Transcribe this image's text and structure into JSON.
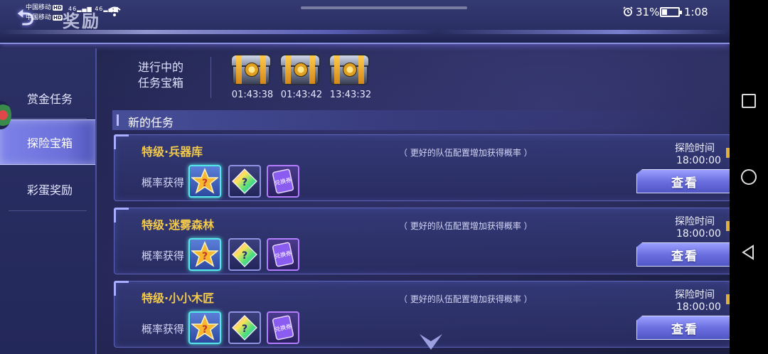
{
  "status_bar": {
    "carrier_1": "中国移动",
    "carrier_2": "中国移动",
    "hd_tag": "HD",
    "signal_1": "46",
    "signal_2": "46",
    "battery_percent": "31%",
    "battery_level": 0.31,
    "time": "1:08"
  },
  "header": {
    "title": "奖励",
    "back_icon": "back-arrow-icon"
  },
  "sidebar": {
    "items": [
      {
        "label": "赏金任务",
        "active": false
      },
      {
        "label": "探险宝箱",
        "active": true
      },
      {
        "label": "彩蛋奖励",
        "active": false
      }
    ]
  },
  "ongoing": {
    "label_line1": "进行中的",
    "label_line2": "任务宝箱",
    "chests": [
      {
        "icon": "treasure-chest-icon",
        "timer": "01:43:38"
      },
      {
        "icon": "treasure-chest-icon",
        "timer": "01:43:42"
      },
      {
        "icon": "treasure-chest-icon",
        "timer": "13:43:32"
      }
    ]
  },
  "new_tasks": {
    "title": "新的任务",
    "tasks": [
      {
        "name": "特级·兵器库",
        "hint": "（ 更好的队伍配置增加获得概率 ）",
        "time_label": "探险时间",
        "time": "18:00:00",
        "prob_label": "概率获得",
        "view_label": "查看",
        "rewards": [
          "star-mystery-icon",
          "gem-mystery-icon",
          "ticket-icon"
        ],
        "ticket_text": "兑换券"
      },
      {
        "name": "特级·迷雾森林",
        "hint": "（ 更好的队伍配置增加获得概率 ）",
        "time_label": "探险时间",
        "time": "18:00:00",
        "prob_label": "概率获得",
        "view_label": "查看",
        "rewards": [
          "star-mystery-icon",
          "gem-mystery-icon",
          "ticket-icon"
        ],
        "ticket_text": "兑换券"
      },
      {
        "name": "特级·小小木匠",
        "hint": "（ 更好的队伍配置增加获得概率 ）",
        "time_label": "探险时间",
        "time": "18:00:00",
        "prob_label": "概率获得",
        "view_label": "查看",
        "rewards": [
          "star-mystery-icon",
          "gem-mystery-icon",
          "ticket-icon"
        ],
        "ticket_text": "兑换券"
      }
    ]
  },
  "colors": {
    "accent_gold": "#f3c94a",
    "button_purple": "#6c6fe0",
    "active_tab": "#7c82e8"
  }
}
